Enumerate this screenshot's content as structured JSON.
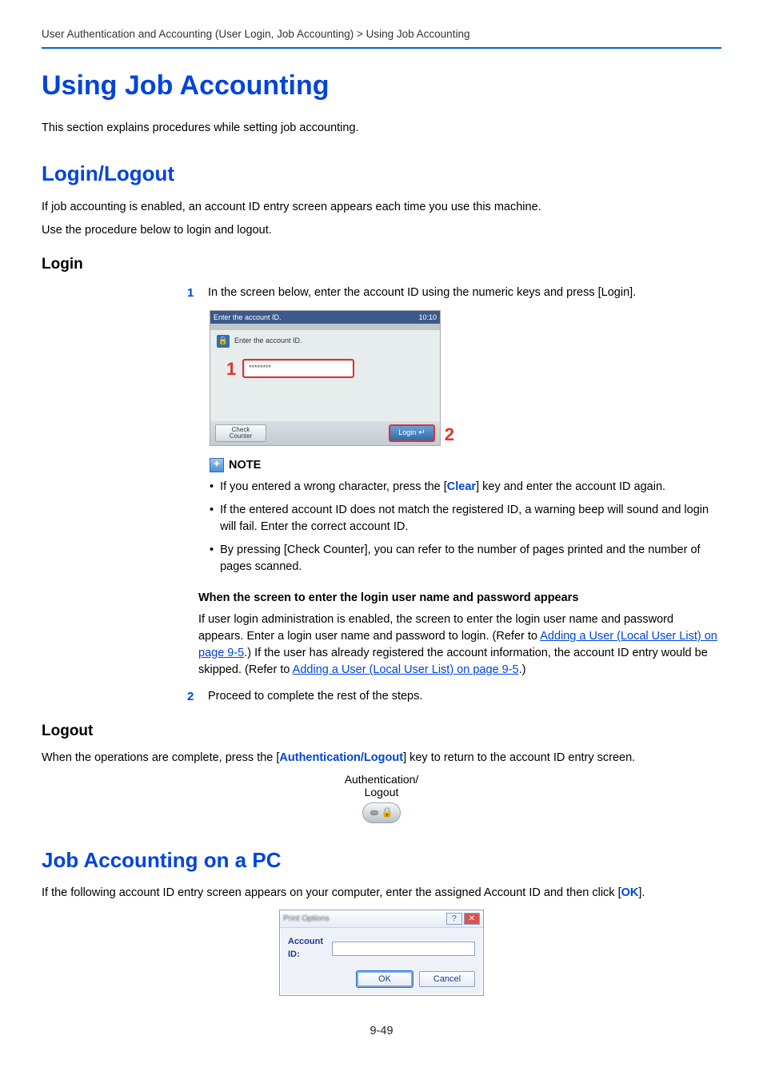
{
  "breadcrumb": "User Authentication and Accounting (User Login, Job Accounting) > Using Job Accounting",
  "h1": "Using Job Accounting",
  "intro": "This section explains procedures while setting job accounting.",
  "sec_login_logout": {
    "heading": "Login/Logout",
    "p1": "If job accounting is enabled, an account ID entry screen appears each time you use this machine.",
    "p2": "Use the procedure below to login and logout."
  },
  "login": {
    "heading": "Login",
    "step1_num": "1",
    "step1_text": "In the screen below, enter the account ID using the numeric keys and press [Login].",
    "device": {
      "title": "Enter the account ID.",
      "time": "10:10",
      "prompt": "Enter the account ID.",
      "input_mask": "********",
      "callout1": "1",
      "callout2": "2",
      "check_line1": "Check",
      "check_line2": "Counter",
      "login_label": "Login"
    },
    "note_label": "NOTE",
    "note_items": {
      "a_pre": "If you entered a wrong character, press the [",
      "a_key": "Clear",
      "a_post": "] key and enter the account ID again.",
      "b": "If the entered account ID does not match the registered ID, a warning beep will sound and login will fail. Enter the correct account ID.",
      "c": "By pressing [Check Counter], you can refer to the number of pages printed and the number of pages scanned."
    },
    "when_heading": "When the screen to enter the login user name and password appears",
    "when_body_pre": "If user login administration is enabled, the screen to enter the login user name and password appears. Enter a login user name and password to login. (Refer to ",
    "when_link1": "Adding a User (Local User List) on page 9-5",
    "when_body_mid": ".) If the user has already registered the account information, the account ID entry would be skipped. (Refer to ",
    "when_link2": "Adding a User (Local User List) on page 9-5",
    "when_body_post": ".)",
    "step2_num": "2",
    "step2_text": "Proceed to complete the rest of the steps."
  },
  "logout": {
    "heading": "Logout",
    "body_pre": "When the operations are complete, press the [",
    "body_key": "Authentication/Logout",
    "body_post": "] key to return to the account ID entry screen.",
    "widget_line1": "Authentication/",
    "widget_line2": "Logout"
  },
  "pc": {
    "heading": "Job Accounting on a PC",
    "body_pre": "If the following account ID entry screen appears on your computer, enter the assigned Account ID and then click [",
    "body_key": "OK",
    "body_post": "].",
    "dialog": {
      "title": "Print Options",
      "help": "?",
      "close": "✕",
      "label": "Account ID:",
      "ok": "OK",
      "cancel": "Cancel"
    }
  },
  "page_number": "9-49"
}
